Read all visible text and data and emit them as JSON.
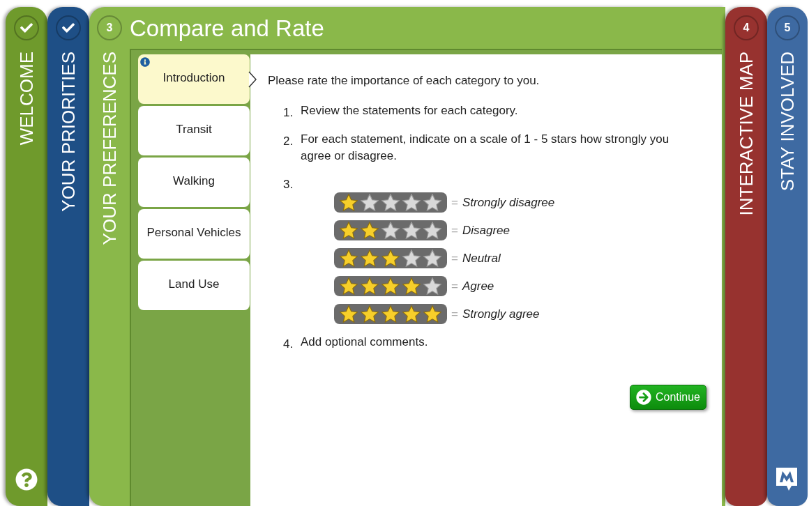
{
  "steps_left": [
    {
      "label": "WELCOME",
      "done": true,
      "color": "#6f9a2c"
    },
    {
      "label": "YOUR PRIORITIES",
      "done": true,
      "color": "#1e4f86"
    }
  ],
  "current_step": {
    "number": "3",
    "label": "YOUR PREFERENCES",
    "title": "Compare and Rate"
  },
  "steps_right": [
    {
      "number": "4",
      "label": "INTERACTIVE MAP",
      "done": false,
      "color": "#97322f"
    },
    {
      "number": "5",
      "label": "STAY INVOLVED",
      "done": false,
      "color": "#3e6aa2"
    }
  ],
  "tabs": [
    {
      "label": "Introduction",
      "selected": true
    },
    {
      "label": "Transit",
      "selected": false
    },
    {
      "label": "Walking",
      "selected": false
    },
    {
      "label": "Personal Vehicles",
      "selected": false
    },
    {
      "label": "Land Use",
      "selected": false
    }
  ],
  "content": {
    "intro": "Please rate the importance of each category to you.",
    "steps": [
      {
        "number": "1.",
        "text": "Review the statements for each category."
      },
      {
        "number": "2.",
        "text": "For each statement, indicate on a scale of 1 - 5 stars how strongly you agree or disagree."
      },
      {
        "number": "3.",
        "kind": "legend"
      },
      {
        "number": "4.",
        "text": "Add optional comments."
      }
    ],
    "legend": [
      {
        "stars": 1,
        "sign": "=",
        "label": "Strongly disagree"
      },
      {
        "stars": 2,
        "sign": "=",
        "label": "Disagree"
      },
      {
        "stars": 3,
        "sign": "=",
        "label": "Neutral"
      },
      {
        "stars": 4,
        "sign": "=",
        "label": "Agree"
      },
      {
        "stars": 5,
        "sign": "=",
        "label": "Strongly agree"
      }
    ],
    "continue_button": "Continue"
  }
}
